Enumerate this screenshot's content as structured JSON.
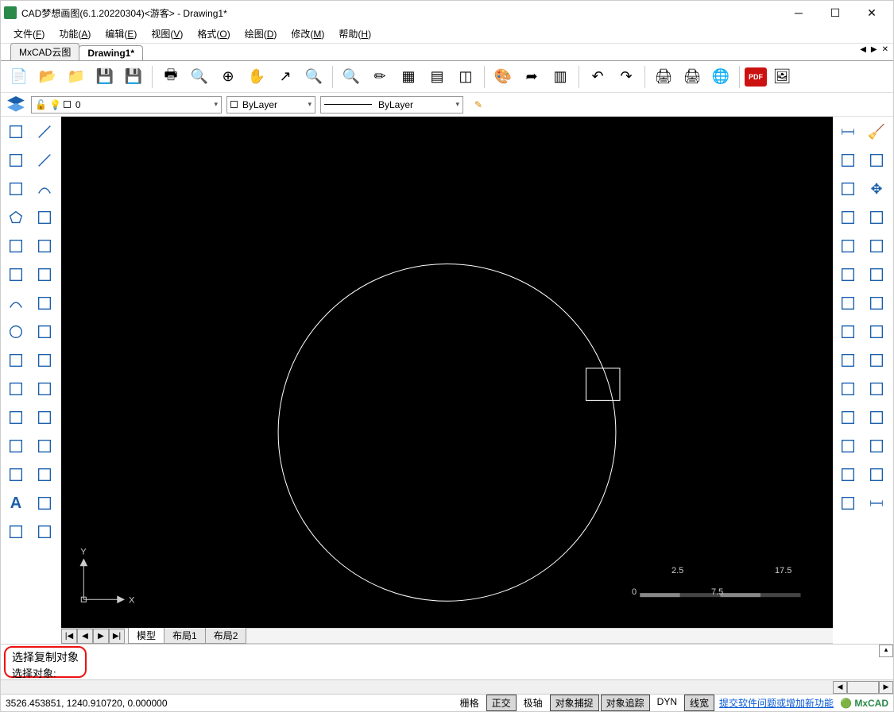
{
  "title": "CAD梦想画图(6.1.20220304)<游客> - Drawing1*",
  "menu": [
    "文件(F)",
    "功能(A)",
    "编辑(E)",
    "视图(V)",
    "格式(O)",
    "绘图(D)",
    "修改(M)",
    "帮助(H)"
  ],
  "docTabs": {
    "items": [
      "MxCAD云图",
      "Drawing1*"
    ],
    "active": 1
  },
  "toolbar": {
    "items": [
      {
        "n": "new-file",
        "g": "📄"
      },
      {
        "n": "open-folder",
        "g": "📂"
      },
      {
        "n": "open",
        "g": "📁"
      },
      {
        "n": "save",
        "g": "💾"
      },
      {
        "n": "save-as",
        "g": "💾"
      },
      {
        "n": "print-preview",
        "g": "🖶"
      },
      {
        "n": "zoom-extents",
        "g": "🔍"
      },
      {
        "n": "zoom-in",
        "g": "⊕"
      },
      {
        "n": "pan",
        "g": "✋"
      },
      {
        "n": "measure",
        "g": "↗"
      },
      {
        "n": "zoom-window",
        "g": "🔍"
      },
      {
        "n": "zoom-out",
        "g": "🔍"
      },
      {
        "n": "highlight",
        "g": "✏"
      },
      {
        "n": "properties",
        "g": "▦"
      },
      {
        "n": "layers",
        "g": "▤"
      },
      {
        "n": "crop",
        "g": "◫"
      },
      {
        "n": "palette",
        "g": "🎨"
      },
      {
        "n": "export",
        "g": "➦"
      },
      {
        "n": "block",
        "g": "▥"
      },
      {
        "n": "undo",
        "g": "↶"
      },
      {
        "n": "redo",
        "g": "↷"
      },
      {
        "n": "print",
        "g": "🖨"
      },
      {
        "n": "plot",
        "g": "🖨"
      },
      {
        "n": "web",
        "g": "🌐"
      },
      {
        "n": "pdf",
        "g": "PDF"
      },
      {
        "n": "image",
        "g": "🖼"
      }
    ]
  },
  "layerBar": {
    "layer": "0",
    "color": "ByLayer",
    "linetype": "ByLayer"
  },
  "leftTools1": [
    "style",
    "hatch",
    "",
    "polygon",
    "roof",
    "rect",
    "arc-tool",
    "circle-tool",
    "spline",
    "ellipse",
    "ellipse2",
    "ring",
    "sun",
    "A",
    "image"
  ],
  "leftTools2": [
    "line",
    "diag",
    "arc",
    "",
    "",
    "",
    "",
    "",
    "",
    "",
    "",
    "",
    "",
    "",
    ""
  ],
  "rightTools1": [
    "dim-linear",
    "dim-aligned",
    "dim-rotate",
    "dim-angle",
    "dim-edit",
    "dim-cont",
    "copy-layer",
    "copy-layer2",
    "copy-layer3",
    "copy-layer4"
  ],
  "rightTools2": [
    "eraser",
    "join",
    "move",
    "rotate",
    "scale",
    "offset",
    "trim",
    "array",
    "mirror",
    "curve",
    "bound",
    "fillet",
    "arc-edit",
    "extend",
    "chamfer",
    "cube",
    "box",
    "dim-h"
  ],
  "canvas": {
    "axis": {
      "xlabel": "X",
      "ylabel": "Y"
    },
    "ruler": {
      "t0": "0",
      "t1": "2.5",
      "t2": "7.5",
      "t3": "17.5"
    }
  },
  "layoutTabs": {
    "items": [
      "模型",
      "布局1",
      "布局2"
    ],
    "active": 0
  },
  "command": {
    "log": "选择复制对象",
    "prompt": "选择对象:"
  },
  "status": {
    "coords": "3526.453851,  1240.910720,  0.000000",
    "toggles": [
      {
        "label": "栅格",
        "active": false
      },
      {
        "label": "正交",
        "active": true
      },
      {
        "label": "极轴",
        "active": false
      },
      {
        "label": "对象捕捉",
        "active": true
      },
      {
        "label": "对象追踪",
        "active": true
      },
      {
        "label": "DYN",
        "active": false
      },
      {
        "label": "线宽",
        "active": true
      }
    ],
    "link": "提交软件问题或增加新功能",
    "logo": "MxCAD"
  }
}
